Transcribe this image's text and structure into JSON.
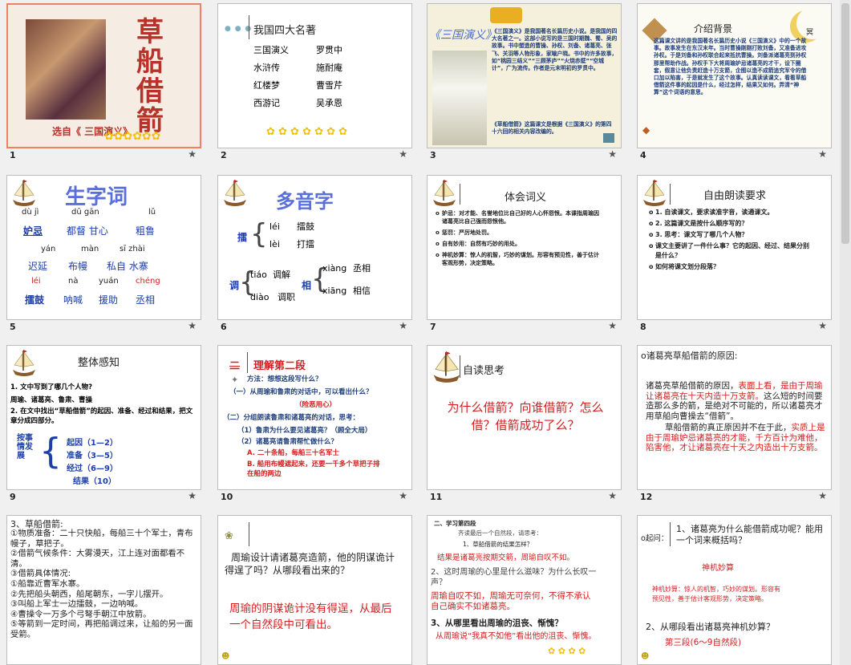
{
  "slides": [
    {
      "num": "1",
      "title": "草船借箭",
      "subtitle": "选自《 三国演义》"
    },
    {
      "num": "2",
      "title": "我国四大名著",
      "books": [
        [
          "三国演义",
          "罗贯中"
        ],
        [
          "水浒传",
          "施耐庵"
        ],
        [
          "红楼梦",
          "曹雪芹"
        ],
        [
          "西游记",
          "吴承恩"
        ]
      ]
    },
    {
      "num": "3",
      "title": "《三国演义》",
      "p1": "《三国演义》是我国著名长篇历史小说。是我国的四大名著之一。这部小说写的是三国时期魏、蜀、吴的故事。书中塑造的曹操、孙权、刘备、诸葛亮、张飞、关羽等人物形象，家喻户晓。书中的许多故事，如“桃园三结义”“三顾茅庐”“火烧赤壁”“空城计”，广为流传。作者是元末明初的罗贯中。",
      "p2": "《草船借箭》这篇课文是根据《三国演义》的第四十六回的相关内容改编的。"
    },
    {
      "num": "4",
      "title": "介绍背景",
      "body": "这篇课文讲的是我国著名长篇历史小说《三国演义》中的一个故事。故事发生在东汉末年。当时曹操刚刚打败刘备，又准备进攻孙权。于是刘备和孙权联合起来抵抗曹操。刘备派诸葛亮到孙权那里帮助作战。孙权手下大将周瑜妒忌诸葛亮的才干，设下圈套，假意让他负责赶造十万支箭，企图以造不成箭追究军令的借口加以陷害，于是就发生了这个故事。认真读读课文，看看草船借箭这件事的起因是什么，经过怎样，结果又如何。弄清“神算”这个词语的意思。",
      "moon_label": "冥"
    },
    {
      "num": "5",
      "title": "生字词",
      "rows": [
        [
          [
            "dù jì",
            "妒忌"
          ],
          [
            "dū gān",
            "都督 甘心"
          ],
          [
            "lǔ",
            "粗鲁"
          ]
        ],
        [
          [
            "yán",
            "迟延"
          ],
          [
            "màn",
            "布幔"
          ],
          [
            "sī zhài",
            "私自 水寨"
          ]
        ],
        [
          [
            "léi",
            "擂鼓"
          ],
          [
            "nà",
            "呐喊"
          ],
          [
            "yuán",
            "援助"
          ],
          [
            "chéng",
            "丞相"
          ]
        ]
      ]
    },
    {
      "num": "6",
      "title": "多音字",
      "c1": "擂",
      "p1a": "léi",
      "w1a": "擂鼓",
      "p1b": "lèi",
      "w1b": "打擂",
      "c2": "调",
      "p2a": "tiáo",
      "w2a": "调解",
      "p2b": "diào",
      "w2b": "调职",
      "c3": "相",
      "p3a": "xiàng",
      "w3a": "丞相",
      "p3b": "xiāng",
      "w3b": "相信"
    },
    {
      "num": "7",
      "title": "体会词义",
      "items": [
        "妒忌：对才能、名誉地位比自己好的人心怀怨恨。本课指周瑜因诸葛亮比自己强而怨恨他。",
        "惩罚：严厉地处罚。",
        "自有妙用：自然有巧妙的用处。",
        "神机妙算：惊人的机智，巧妙的谋划。形容有预见性，善于估计客观形势，决定策略。"
      ]
    },
    {
      "num": "8",
      "title": "自由朗读要求",
      "items": [
        "1. 自读课文，要求读准字音，读通课文。",
        "2. 这篇课文是按什么顺序写的？",
        "3. 思考：课文写了哪几个人物？",
        "课文主要讲了一件什么事？它的起因、经过、结果分别是什么？",
        "如何将课文划分段落？"
      ]
    },
    {
      "num": "9",
      "title": "整体感知",
      "q1": "1. 文中写到了哪几个人物?",
      "a1": "周瑜、诸葛亮、鲁肃、曹操",
      "q2": "2. 在文中找出“草船借箭”的起因、准备、经过和结果，把文章分成四部分。",
      "side": "按事情发展",
      "parts": [
        "起因（1—2）",
        "准备（3—5）",
        "经过（6—9）",
        "结果（10）"
      ]
    },
    {
      "num": "10",
      "title": "理解第二段",
      "prefix": "二",
      "l1": "方法：想想这段写什么？",
      "l2": "（一）从周瑜和鲁肃的对话中，可以看出什么？",
      "l3": "（险恶用心）",
      "l4": "（二）分组朗读鲁肃和诸葛亮的对话，思考：",
      "l5": "（1）鲁肃为什么要见诸葛亮？（顾全大局）",
      "l6": "（2）诸葛亮请鲁肃帮忙做什么？",
      "l7": "A. 二十条船，每船三十名军士",
      "l8": "B. 船用布幔遮起来，还要一千多个草把子排在船的两边"
    },
    {
      "num": "11",
      "title": "自读思考",
      "q": "为什么借箭？向谁借箭？怎么借？借箭成功了么？"
    },
    {
      "num": "12",
      "l1": "诸葛亮草船借箭的原因:",
      "l2a": "诸葛亮草船借箭的原因，",
      "l2b": "表面上看，是由于周瑜让诸葛亮在十天内造十万支箭。",
      "l2c": "这么短的时间要造那么多的箭，是绝对不可能的，所以诸葛亮才用草船向曹操去“借箭”。",
      "l3a": "草船借箭的真正原因并不在于此，",
      "l3b": "实质上是由于周瑜妒忌诸葛亮的才能，千方百计为难他，陷害他，才让诸葛亮在十天之内造出十万支箭。"
    },
    {
      "num": "13",
      "title": "3、草船借箭:",
      "lines": [
        "①物质准备：二十只快船，每船三十个军士，青布幔子，草把子。",
        "②借箭气候条件：大雾漫天，江上连对面都看不清。",
        "③借箭具体情况:",
        "①船靠近曹军水寨。",
        "②先把船头朝西，船尾朝东，一字儿摆开。",
        "③叫船上军士一边擂鼓，一边呐喊。",
        "④曹操令一万多个弓弩手朝江中放箭。",
        "⑤等箭到一定时间，再把船调过来，让船的另一面受箭。"
      ]
    },
    {
      "num": "14",
      "q": "周瑜设计请诸葛亮造箭，他的阴谋诡计得逞了吗？从哪段看出来的？",
      "a": "周瑜的阴谋诡计没有得逞，从最后一个自然段中可看出。"
    },
    {
      "num": "15",
      "title": "二、学习第四段",
      "l1": "齐读最后一个自然段，请思考：",
      "l2": "1、草船借箭的结果怎样？",
      "l3": "结果是诸葛亮按期交箭，周瑜自叹不如。",
      "l4": "2、这时周瑜的心里是什么滋味？为什么长叹一声？",
      "l5": "周瑜自叹不如，周瑜无可奈何，不得不承认自己确实不如诸葛亮。",
      "l6": "3、从哪里看出周瑜的沮丧、惭愧？",
      "l7": "从周瑜说“我真不如他”看出他的沮丧、惭愧。"
    },
    {
      "num": "16",
      "q1label": "起问：",
      "q1": "1、诸葛亮为什么能借箭成功呢？能用一个词来概括吗？",
      "kw": "神机妙算",
      "def": "神机妙算：惊人的机智，巧妙的谋划。形容有预见性，善于估计客观形势，决定策略。",
      "q2": "2、从哪段看出诸葛亮神机妙算？",
      "a2": "第三段(6～9自然段)"
    }
  ],
  "star": "★",
  "colors": {
    "title_red": "#b8322a",
    "blue": "#1d3fa8",
    "red": "#d32020",
    "green": "#0a7a4a"
  }
}
